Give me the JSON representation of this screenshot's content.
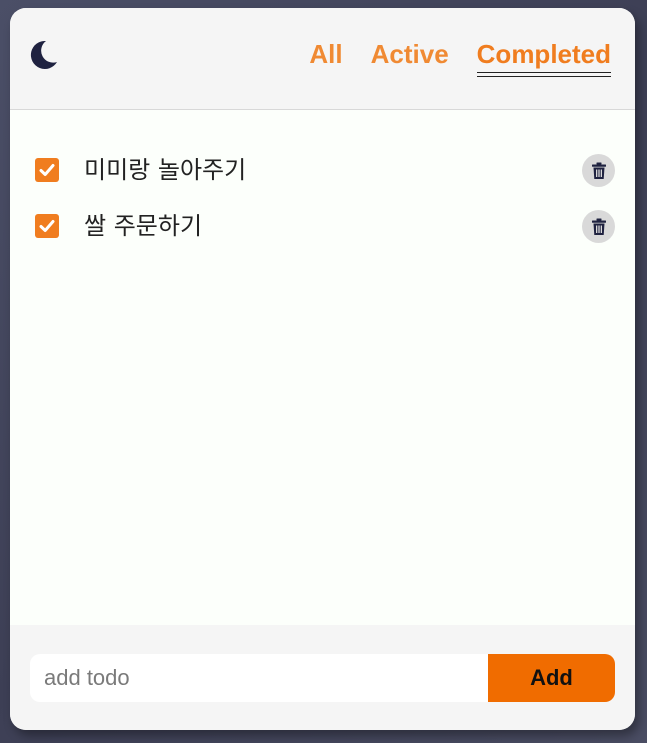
{
  "header": {
    "theme_icon": "moon-icon",
    "filters": [
      {
        "label": "All",
        "selected": false
      },
      {
        "label": "Active",
        "selected": false
      },
      {
        "label": "Completed",
        "selected": true
      }
    ]
  },
  "todos": [
    {
      "text": "미미랑 놀아주기",
      "completed": true,
      "delete_icon": "trash-icon"
    },
    {
      "text": "쌀 주문하기",
      "completed": true,
      "delete_icon": "trash-icon"
    }
  ],
  "footer": {
    "input_placeholder": "add todo",
    "input_value": "",
    "add_label": "Add"
  },
  "colors": {
    "accent": "#f07d1f",
    "add_button": "#f06c00",
    "moon": "#1f2240",
    "header_bg": "#f5f5f5",
    "list_bg": "#fcfffb"
  }
}
